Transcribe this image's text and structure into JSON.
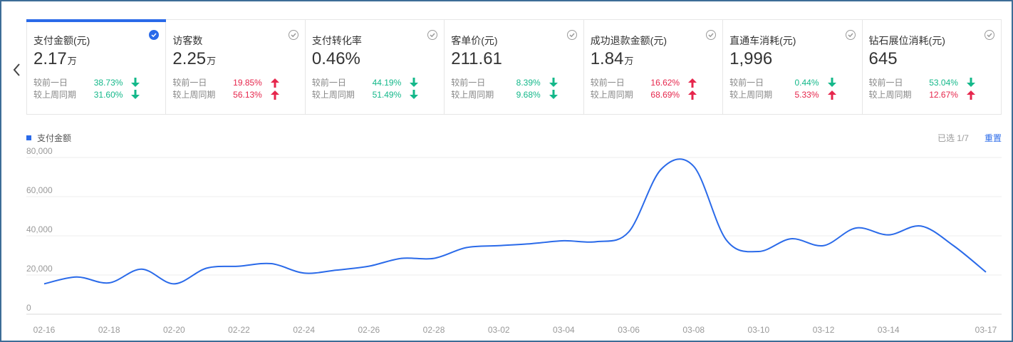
{
  "nav": {
    "prev_icon": "chevron-left-icon"
  },
  "colors": {
    "accent": "#2a6ae9",
    "down": "#14b88a",
    "up": "#e6264c",
    "line": "#2a6ae9"
  },
  "cards": [
    {
      "title": "支付金额(元)",
      "value": "2.17",
      "unit": "万",
      "active": true,
      "day_label": "较前一日",
      "day_value": "38.73%",
      "day_dir": "down",
      "week_label": "较上周同期",
      "week_value": "31.60%",
      "week_dir": "down"
    },
    {
      "title": "访客数",
      "value": "2.25",
      "unit": "万",
      "active": false,
      "day_label": "较前一日",
      "day_value": "19.85%",
      "day_dir": "up",
      "week_label": "较上周同期",
      "week_value": "56.13%",
      "week_dir": "up"
    },
    {
      "title": "支付转化率",
      "value": "0.46%",
      "unit": "",
      "active": false,
      "day_label": "较前一日",
      "day_value": "44.19%",
      "day_dir": "down",
      "week_label": "较上周同期",
      "week_value": "51.49%",
      "week_dir": "down"
    },
    {
      "title": "客单价(元)",
      "value": "211.61",
      "unit": "",
      "active": false,
      "day_label": "较前一日",
      "day_value": "8.39%",
      "day_dir": "down",
      "week_label": "较上周同期",
      "week_value": "9.68%",
      "week_dir": "down"
    },
    {
      "title": "成功退款金额(元)",
      "value": "1.84",
      "unit": "万",
      "active": false,
      "day_label": "较前一日",
      "day_value": "16.62%",
      "day_dir": "up",
      "week_label": "较上周同期",
      "week_value": "68.69%",
      "week_dir": "up"
    },
    {
      "title": "直通车消耗(元)",
      "value": "1,996",
      "unit": "",
      "active": false,
      "day_label": "较前一日",
      "day_value": "0.44%",
      "day_dir": "down",
      "week_label": "较上周同期",
      "week_value": "5.33%",
      "week_dir": "up"
    },
    {
      "title": "钻石展位消耗(元)",
      "value": "645",
      "unit": "",
      "active": false,
      "day_label": "较前一日",
      "day_value": "53.04%",
      "day_dir": "down",
      "week_label": "较上周同期",
      "week_value": "12.67%",
      "week_dir": "up"
    }
  ],
  "legend": {
    "label": "支付金额"
  },
  "selected_info": "已选 1/7",
  "reset_label": "重置",
  "chart_data": {
    "type": "line",
    "title": "",
    "xlabel": "",
    "ylabel": "",
    "ylim": [
      0,
      80000
    ],
    "yticks": [
      "0",
      "20,000",
      "40,000",
      "60,000",
      "80,000"
    ],
    "ytick_values": [
      0,
      20000,
      40000,
      60000,
      80000
    ],
    "xticks": [
      "02-16",
      "02-18",
      "02-20",
      "02-22",
      "02-24",
      "02-26",
      "02-28",
      "03-02",
      "03-04",
      "03-06",
      "03-08",
      "03-10",
      "03-12",
      "03-14",
      "03-17"
    ],
    "grid": true,
    "legend_position": "top-left",
    "x": [
      "02-16",
      "02-17",
      "02-18",
      "02-19",
      "02-20",
      "02-21",
      "02-22",
      "02-23",
      "02-24",
      "02-25",
      "02-26",
      "02-27",
      "02-28",
      "03-01",
      "03-02",
      "03-03",
      "03-04",
      "03-05",
      "03-06",
      "03-07",
      "03-08",
      "03-09",
      "03-10",
      "03-11",
      "03-12",
      "03-13",
      "03-14",
      "03-15",
      "03-16",
      "03-17"
    ],
    "series": [
      {
        "name": "支付金额",
        "values": [
          15500,
          19000,
          16000,
          23000,
          15500,
          23500,
          24500,
          25800,
          21000,
          22500,
          24500,
          28500,
          28500,
          34000,
          35000,
          36000,
          37500,
          37000,
          42000,
          74000,
          75500,
          38000,
          32000,
          38500,
          35000,
          44000,
          40500,
          45000,
          35000,
          21500
        ]
      }
    ]
  }
}
